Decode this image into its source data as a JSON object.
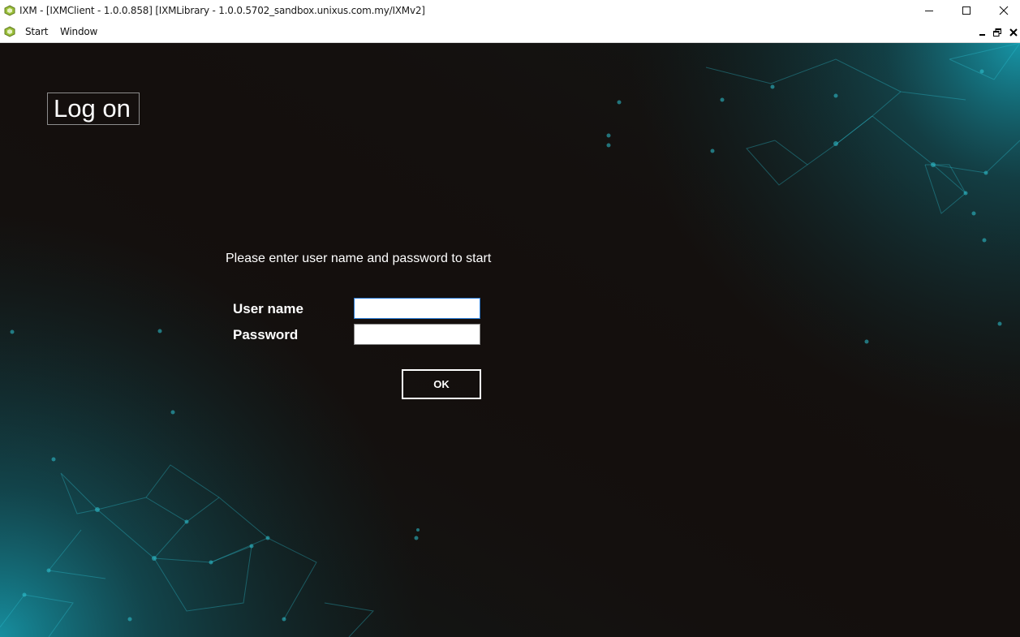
{
  "window": {
    "title": "IXM - [IXMClient - 1.0.0.858] [IXMLibrary - 1.0.0.5702_sandbox.unixus.com.my/IXMv2]"
  },
  "menu": {
    "items": [
      "Start",
      "Window"
    ]
  },
  "login": {
    "title": "Log on",
    "prompt": "Please enter user name and password to start",
    "username_label": "User name",
    "username_value": "",
    "password_label": "Password",
    "password_value": "",
    "ok_label": "OK"
  },
  "colors": {
    "background": "#140f0d",
    "accent_teal": "#18b3c9",
    "input_focus_border": "#2a7bd4"
  }
}
